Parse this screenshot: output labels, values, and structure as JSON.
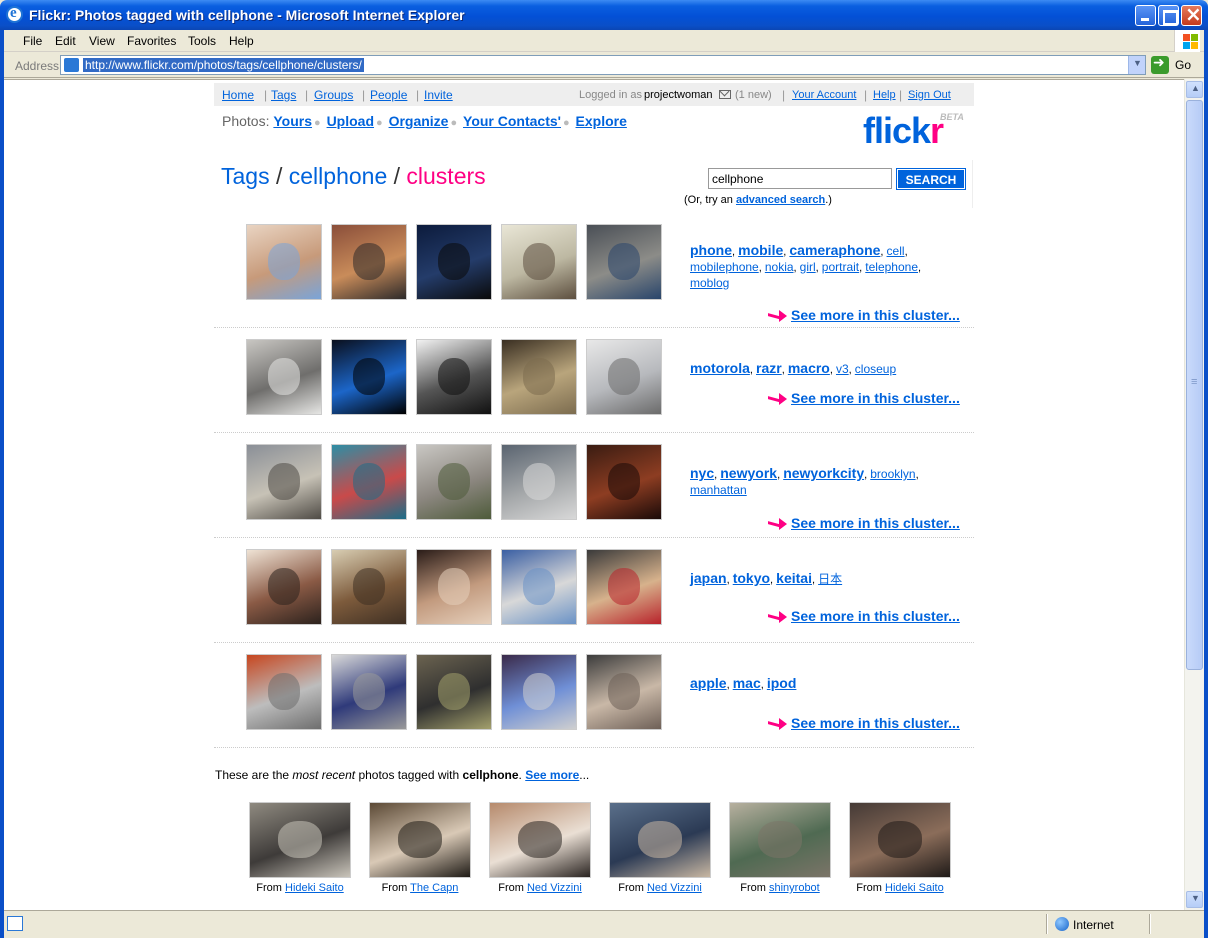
{
  "window": {
    "title": "Flickr: Photos tagged with cellphone - Microsoft Internet Explorer",
    "menu": [
      "File",
      "Edit",
      "View",
      "Favorites",
      "Tools",
      "Help"
    ],
    "address_label": "Address",
    "url": "http://www.flickr.com/photos/tags/cellphone/clusters/",
    "go_label": "Go",
    "status_zone": "Internet"
  },
  "topnav": {
    "links": [
      "Home",
      "Tags",
      "Groups",
      "People",
      "Invite"
    ],
    "logged_in_prefix": "Logged in as",
    "username": "projectwoman",
    "mail_new": "(1 new)",
    "account": "Your Account",
    "help": "Help",
    "sign_out": "Sign Out"
  },
  "photos_nav": {
    "label": "Photos:",
    "links": [
      "Yours",
      "Upload",
      "Organize",
      "Your Contacts'",
      "Explore"
    ]
  },
  "logo": {
    "part1": "flick",
    "part2": "r",
    "beta": "BETA"
  },
  "breadcrumb": {
    "tags": "Tags",
    "tag": "cellphone",
    "current": "clusters",
    "sep": "/"
  },
  "search": {
    "value": "cellphone",
    "button": "SEARCH",
    "note_prefix": "(Or, try an",
    "note_link": "advanced search",
    "note_suffix": ".)"
  },
  "clusters": [
    {
      "tags_big": [
        "phone",
        "mobile",
        "cameraphone"
      ],
      "tags_small": [
        "cell",
        "mobilephone",
        "nokia",
        "girl",
        "portrait",
        "telephone",
        "moblog"
      ],
      "more": "See more in this cluster..."
    },
    {
      "tags_big": [
        "motorola",
        "razr",
        "macro"
      ],
      "tags_small": [
        "v3",
        "closeup"
      ],
      "more": "See more in this cluster..."
    },
    {
      "tags_big": [
        "nyc",
        "newyork",
        "newyorkcity"
      ],
      "tags_small": [
        "brooklyn",
        "manhattan"
      ],
      "more": "See more in this cluster..."
    },
    {
      "tags_big": [
        "japan",
        "tokyo",
        "keitai"
      ],
      "tags_small": [
        "日本"
      ],
      "more": "See more in this cluster..."
    },
    {
      "tags_big": [
        "apple",
        "mac",
        "ipod"
      ],
      "tags_small": [],
      "more": "See more in this cluster..."
    }
  ],
  "recent": {
    "text_a": "These are the",
    "text_em": "most recent",
    "text_b": "photos tagged with",
    "tag": "cellphone",
    "period": ".",
    "see_more": "See more",
    "ellipsis": "...",
    "from_label": "From",
    "items": [
      {
        "user": "Hideki Saito"
      },
      {
        "user": "The Capn"
      },
      {
        "user": "Ned Vizzini"
      },
      {
        "user": "Ned Vizzini"
      },
      {
        "user": "shinyrobot"
      },
      {
        "user": "Hideki Saito"
      }
    ]
  },
  "colors": {
    "flickr_blue": "#0063dc",
    "flickr_pink": "#ff0084",
    "xp_blue": "#0a4fc8"
  }
}
